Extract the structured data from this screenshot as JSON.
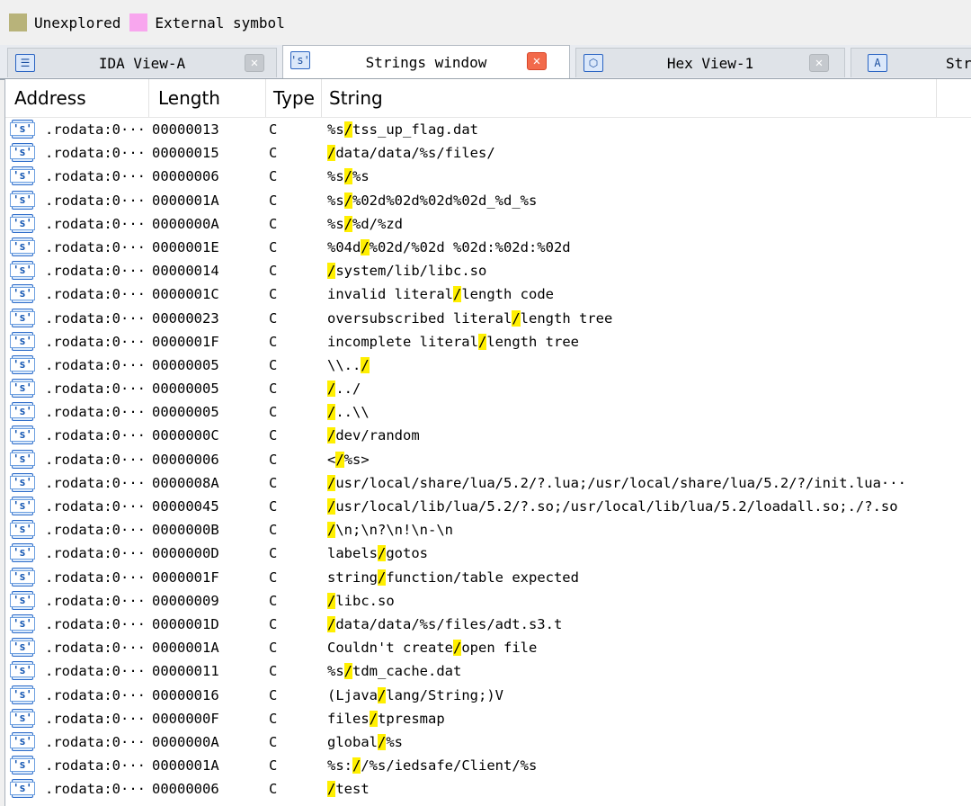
{
  "legend": [
    {
      "label": "Unexplored",
      "color": "#b8b37a"
    },
    {
      "label": "External symbol",
      "color": "#f8a6ee"
    }
  ],
  "tabs": [
    {
      "label": "IDA View-A",
      "icon": "ida-view-icon",
      "icon_glyph": "☰",
      "close": "✕",
      "active": false
    },
    {
      "label": "Strings window",
      "icon": "strings-icon",
      "icon_glyph": "'s'",
      "close": "✕",
      "active": true
    },
    {
      "label": "Hex View-1",
      "icon": "hex-view-icon",
      "icon_glyph": "⬡",
      "close": "✕",
      "active": false
    },
    {
      "label": "Str",
      "icon": "structures-icon",
      "icon_glyph": "A",
      "close": "",
      "active": false
    }
  ],
  "columns": {
    "address": "Address",
    "length": "Length",
    "type": "Type",
    "string": "String"
  },
  "row_icon": "'s'",
  "rows": [
    {
      "address": ".rodata:0···",
      "length": "00000013",
      "type": "C",
      "pre": "%s",
      "hl": "/",
      "post": "tss_up_flag.dat"
    },
    {
      "address": ".rodata:0···",
      "length": "00000015",
      "type": "C",
      "pre": "",
      "hl": "/",
      "post": "data/data/%s/files/"
    },
    {
      "address": ".rodata:0···",
      "length": "00000006",
      "type": "C",
      "pre": "%s",
      "hl": "/",
      "post": "%s"
    },
    {
      "address": ".rodata:0···",
      "length": "0000001A",
      "type": "C",
      "pre": "%s",
      "hl": "/",
      "post": "%02d%02d%02d%02d_%d_%s"
    },
    {
      "address": ".rodata:0···",
      "length": "0000000A",
      "type": "C",
      "pre": "%s",
      "hl": "/",
      "post": "%d/%zd"
    },
    {
      "address": ".rodata:0···",
      "length": "0000001E",
      "type": "C",
      "pre": "%04d",
      "hl": "/",
      "post": "%02d/%02d %02d:%02d:%02d"
    },
    {
      "address": ".rodata:0···",
      "length": "00000014",
      "type": "C",
      "pre": "",
      "hl": "/",
      "post": "system/lib/libc.so"
    },
    {
      "address": ".rodata:0···",
      "length": "0000001C",
      "type": "C",
      "pre": "invalid literal",
      "hl": "/",
      "post": "length code"
    },
    {
      "address": ".rodata:0···",
      "length": "00000023",
      "type": "C",
      "pre": "oversubscribed literal",
      "hl": "/",
      "post": "length tree"
    },
    {
      "address": ".rodata:0···",
      "length": "0000001F",
      "type": "C",
      "pre": "incomplete literal",
      "hl": "/",
      "post": "length tree"
    },
    {
      "address": ".rodata:0···",
      "length": "00000005",
      "type": "C",
      "pre": "\\\\..",
      "hl": "/",
      "post": ""
    },
    {
      "address": ".rodata:0···",
      "length": "00000005",
      "type": "C",
      "pre": "",
      "hl": "/",
      "post": "../"
    },
    {
      "address": ".rodata:0···",
      "length": "00000005",
      "type": "C",
      "pre": "",
      "hl": "/",
      "post": "..\\\\"
    },
    {
      "address": ".rodata:0···",
      "length": "0000000C",
      "type": "C",
      "pre": "",
      "hl": "/",
      "post": "dev/random"
    },
    {
      "address": ".rodata:0···",
      "length": "00000006",
      "type": "C",
      "pre": "<",
      "hl": "/",
      "post": "%s>"
    },
    {
      "address": ".rodata:0···",
      "length": "0000008A",
      "type": "C",
      "pre": "",
      "hl": "/",
      "post": "usr/local/share/lua/5.2/?.lua;/usr/local/share/lua/5.2/?/init.lua···"
    },
    {
      "address": ".rodata:0···",
      "length": "00000045",
      "type": "C",
      "pre": "",
      "hl": "/",
      "post": "usr/local/lib/lua/5.2/?.so;/usr/local/lib/lua/5.2/loadall.so;./?.so"
    },
    {
      "address": ".rodata:0···",
      "length": "0000000B",
      "type": "C",
      "pre": "",
      "hl": "/",
      "post": "\\n;\\n?\\n!\\n-\\n"
    },
    {
      "address": ".rodata:0···",
      "length": "0000000D",
      "type": "C",
      "pre": "labels",
      "hl": "/",
      "post": "gotos"
    },
    {
      "address": ".rodata:0···",
      "length": "0000001F",
      "type": "C",
      "pre": "string",
      "hl": "/",
      "post": "function/table expected"
    },
    {
      "address": ".rodata:0···",
      "length": "00000009",
      "type": "C",
      "pre": "",
      "hl": "/",
      "post": "libc.so"
    },
    {
      "address": ".rodata:0···",
      "length": "0000001D",
      "type": "C",
      "pre": "",
      "hl": "/",
      "post": "data/data/%s/files/adt.s3.t"
    },
    {
      "address": ".rodata:0···",
      "length": "0000001A",
      "type": "C",
      "pre": "Couldn't create",
      "hl": "/",
      "post": "open file"
    },
    {
      "address": ".rodata:0···",
      "length": "00000011",
      "type": "C",
      "pre": "%s",
      "hl": "/",
      "post": "tdm_cache.dat"
    },
    {
      "address": ".rodata:0···",
      "length": "00000016",
      "type": "C",
      "pre": "(Ljava",
      "hl": "/",
      "post": "lang/String;)V"
    },
    {
      "address": ".rodata:0···",
      "length": "0000000F",
      "type": "C",
      "pre": "files",
      "hl": "/",
      "post": "tpresmap"
    },
    {
      "address": ".rodata:0···",
      "length": "0000000A",
      "type": "C",
      "pre": "global",
      "hl": "/",
      "post": "%s"
    },
    {
      "address": ".rodata:0···",
      "length": "0000001A",
      "type": "C",
      "pre": "%s:",
      "hl": "/",
      "post": "/%s/iedsafe/Client/%s"
    },
    {
      "address": ".rodata:0···",
      "length": "00000006",
      "type": "C",
      "pre": "",
      "hl": "/",
      "post": "test"
    }
  ]
}
